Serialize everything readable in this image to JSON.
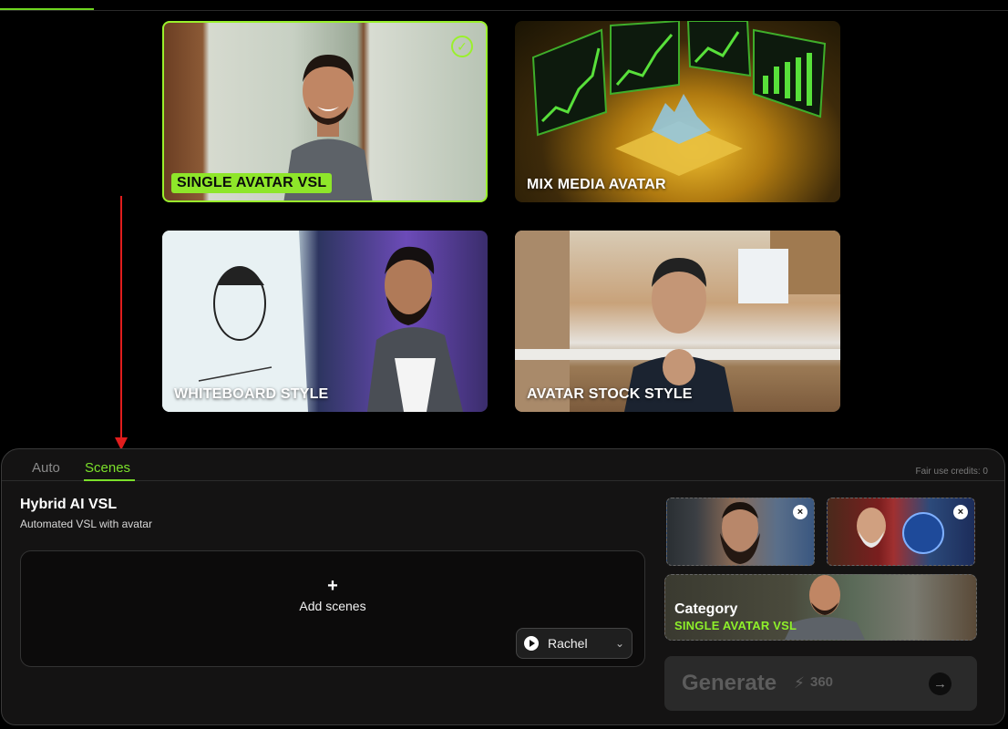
{
  "cards": [
    {
      "label": "SINGLE AVATAR VSL",
      "selected": true
    },
    {
      "label": "MIX MEDIA AVATAR",
      "selected": false
    },
    {
      "label": "WHITEBOARD STYLE",
      "selected": false
    },
    {
      "label": "AVATAR STOCK STYLE",
      "selected": false
    }
  ],
  "colors": {
    "accent": "#8ee62a",
    "annotation_arrow": "#e11d1d"
  },
  "panel": {
    "tabs": [
      {
        "label": "Auto",
        "active": false
      },
      {
        "label": "Scenes",
        "active": true
      }
    ],
    "credits": "Fair use credits: 0",
    "title": "Hybrid AI VSL",
    "subtitle": "Automated VSL with avatar",
    "add_scenes_icon": "+",
    "add_scenes_label": "Add scenes",
    "voice": {
      "name": "Rachel",
      "icon": "play-icon"
    },
    "category": {
      "title": "Category",
      "value": "SINGLE AVATAR VSL"
    },
    "generate": {
      "label": "Generate",
      "cost": "360",
      "icon": "bolt-icon"
    }
  }
}
